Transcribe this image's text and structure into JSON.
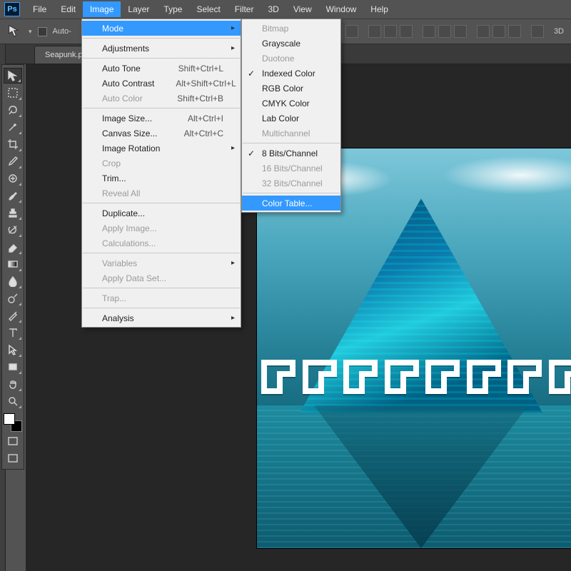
{
  "app": {
    "logo_text": "Ps"
  },
  "menubar": [
    "File",
    "Edit",
    "Image",
    "Layer",
    "Type",
    "Select",
    "Filter",
    "3D",
    "View",
    "Window",
    "Help"
  ],
  "menubar_active_index": 2,
  "optbar": {
    "autoselect_label": "Auto-",
    "threeD_label": "3D"
  },
  "doc_tab": "Seapunk.ps",
  "menu_image": [
    {
      "t": "row",
      "label": "Mode",
      "sub": true,
      "hl": true
    },
    {
      "t": "sep"
    },
    {
      "t": "row",
      "label": "Adjustments",
      "sub": true
    },
    {
      "t": "sep"
    },
    {
      "t": "row",
      "label": "Auto Tone",
      "shortcut": "Shift+Ctrl+L"
    },
    {
      "t": "row",
      "label": "Auto Contrast",
      "shortcut": "Alt+Shift+Ctrl+L"
    },
    {
      "t": "row",
      "label": "Auto Color",
      "shortcut": "Shift+Ctrl+B",
      "disabled": true
    },
    {
      "t": "sep"
    },
    {
      "t": "row",
      "label": "Image Size...",
      "shortcut": "Alt+Ctrl+I"
    },
    {
      "t": "row",
      "label": "Canvas Size...",
      "shortcut": "Alt+Ctrl+C"
    },
    {
      "t": "row",
      "label": "Image Rotation",
      "sub": true
    },
    {
      "t": "row",
      "label": "Crop",
      "disabled": true
    },
    {
      "t": "row",
      "label": "Trim..."
    },
    {
      "t": "row",
      "label": "Reveal All",
      "disabled": true
    },
    {
      "t": "sep"
    },
    {
      "t": "row",
      "label": "Duplicate..."
    },
    {
      "t": "row",
      "label": "Apply Image...",
      "disabled": true
    },
    {
      "t": "row",
      "label": "Calculations...",
      "disabled": true
    },
    {
      "t": "sep"
    },
    {
      "t": "row",
      "label": "Variables",
      "sub": true,
      "disabled": true
    },
    {
      "t": "row",
      "label": "Apply Data Set...",
      "disabled": true
    },
    {
      "t": "sep"
    },
    {
      "t": "row",
      "label": "Trap...",
      "disabled": true
    },
    {
      "t": "sep"
    },
    {
      "t": "row",
      "label": "Analysis",
      "sub": true
    }
  ],
  "menu_mode": [
    {
      "t": "row",
      "label": "Bitmap",
      "disabled": true
    },
    {
      "t": "row",
      "label": "Grayscale"
    },
    {
      "t": "row",
      "label": "Duotone",
      "disabled": true
    },
    {
      "t": "row",
      "label": "Indexed Color",
      "checked": true
    },
    {
      "t": "row",
      "label": "RGB Color"
    },
    {
      "t": "row",
      "label": "CMYK Color"
    },
    {
      "t": "row",
      "label": "Lab Color"
    },
    {
      "t": "row",
      "label": "Multichannel",
      "disabled": true
    },
    {
      "t": "sep"
    },
    {
      "t": "row",
      "label": "8 Bits/Channel",
      "checked": true
    },
    {
      "t": "row",
      "label": "16 Bits/Channel",
      "disabled": true
    },
    {
      "t": "row",
      "label": "32 Bits/Channel",
      "disabled": true
    },
    {
      "t": "sep"
    },
    {
      "t": "row",
      "label": "Color Table...",
      "hl": true
    }
  ],
  "tools": [
    "move",
    "marquee",
    "lasso",
    "wand",
    "crop",
    "eyedropper",
    "healing",
    "brush",
    "stamp",
    "history-brush",
    "eraser",
    "gradient",
    "blur",
    "dodge",
    "pen",
    "type",
    "path-select",
    "rectangle",
    "hand",
    "zoom"
  ]
}
